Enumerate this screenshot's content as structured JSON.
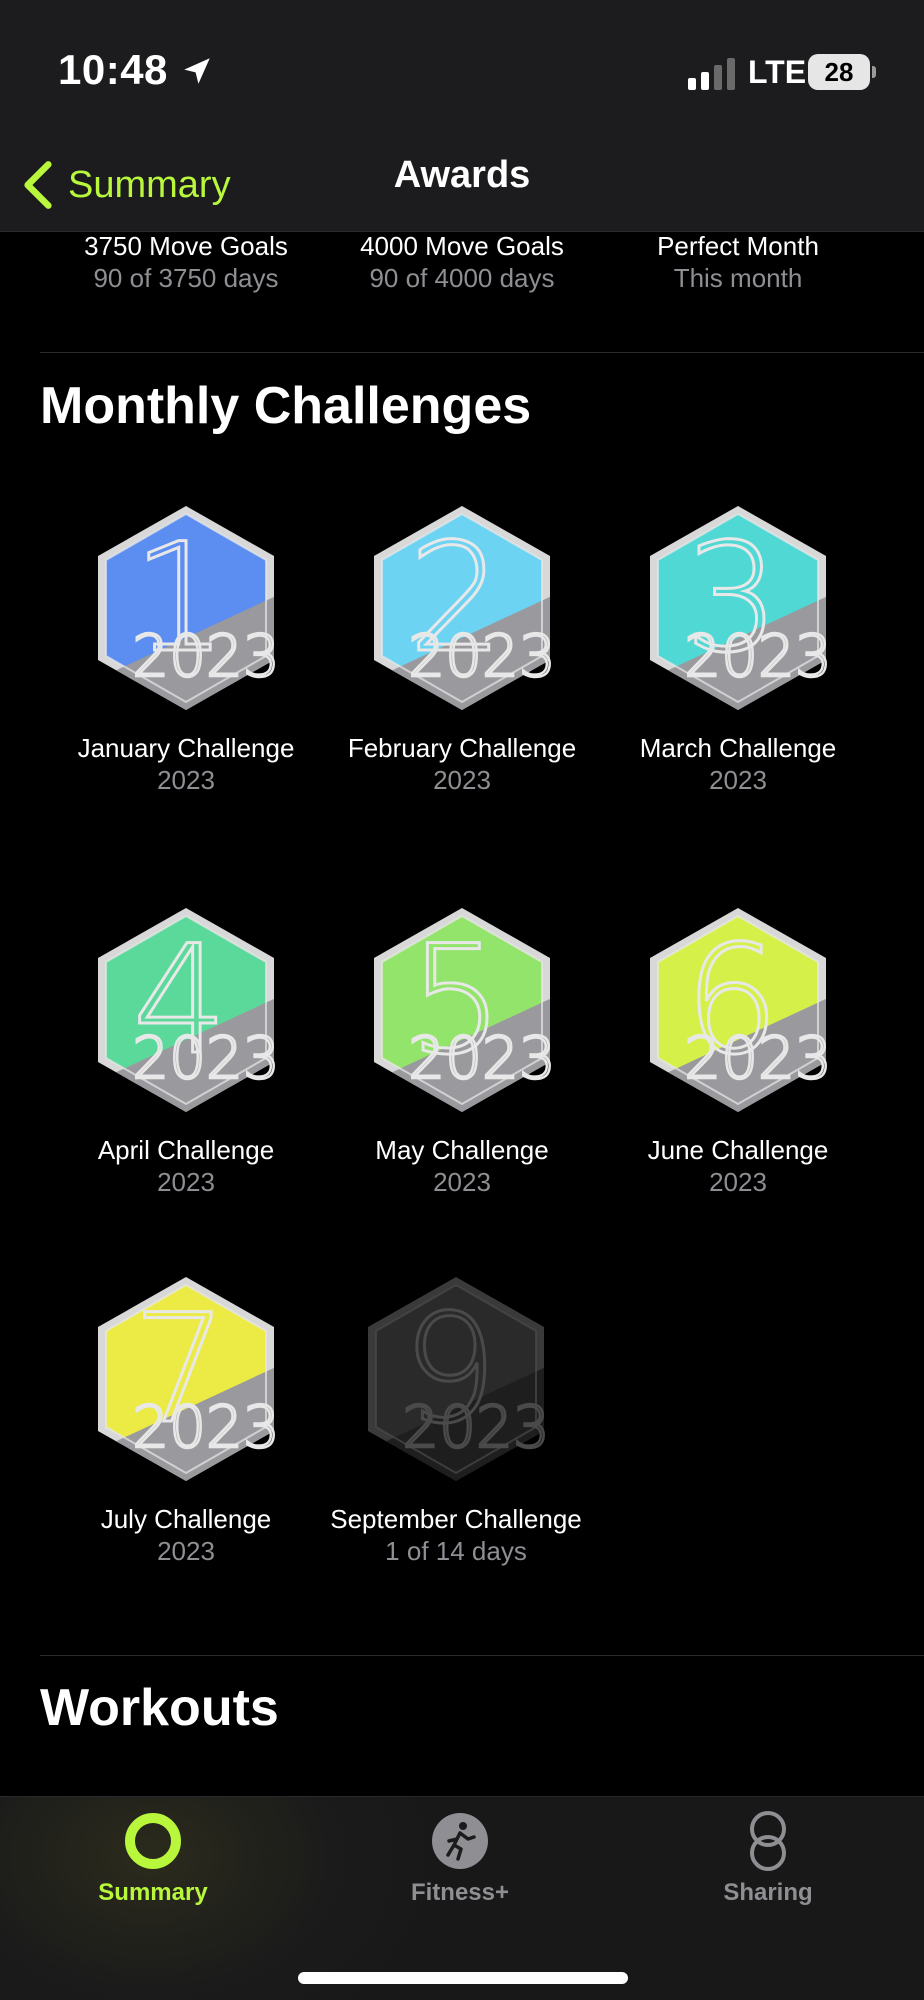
{
  "status_bar": {
    "time": "10:48",
    "network": "LTE",
    "battery": "28"
  },
  "nav": {
    "back_label": "Summary",
    "title": "Awards"
  },
  "goals": [
    {
      "title": "3750 Move Goals",
      "subtitle": "90 of 3750 days"
    },
    {
      "title": "4000 Move Goals",
      "subtitle": "90 of 4000 days"
    },
    {
      "title": "Perfect Month",
      "subtitle": "This month"
    }
  ],
  "sections": {
    "monthly": "Monthly Challenges",
    "workouts": "Workouts"
  },
  "challenges": [
    {
      "title": "January Challenge",
      "subtitle": "2023",
      "numeral": "1",
      "color": "#5b8ef0"
    },
    {
      "title": "February Challenge",
      "subtitle": "2023",
      "numeral": "2",
      "color": "#6dd3f3"
    },
    {
      "title": "March Challenge",
      "subtitle": "2023",
      "numeral": "3",
      "color": "#4fd8d4"
    },
    {
      "title": "April Challenge",
      "subtitle": "2023",
      "numeral": "4",
      "color": "#5ad99a"
    },
    {
      "title": "May Challenge",
      "subtitle": "2023",
      "numeral": "5",
      "color": "#93e46a"
    },
    {
      "title": "June Challenge",
      "subtitle": "2023",
      "numeral": "6",
      "color": "#d6f04a"
    },
    {
      "title": "July Challenge",
      "subtitle": "2023",
      "numeral": "7",
      "color": "#ecea45"
    },
    {
      "title": "September Challenge",
      "subtitle": "1 of 14 days",
      "numeral": "9",
      "color": "#2a2a2a"
    }
  ],
  "tabs": [
    {
      "label": "Summary",
      "active": true
    },
    {
      "label": "Fitness+",
      "active": false
    },
    {
      "label": "Sharing",
      "active": false
    }
  ],
  "colors": {
    "accent": "#b8f73c",
    "secondary_text": "#8e8e93",
    "inactive_tab": "#8e8e93"
  }
}
